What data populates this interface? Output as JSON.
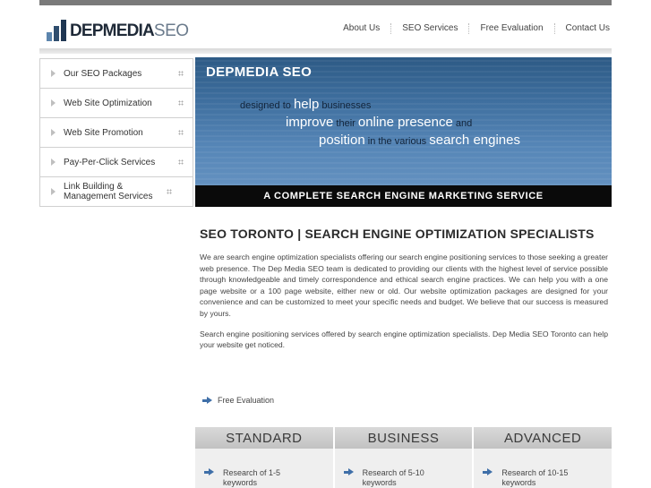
{
  "logo": {
    "main": "DEPMEDIA",
    "suffix": "SEO"
  },
  "topnav": [
    "About Us",
    "SEO Services",
    "Free Evaluation",
    "Contact Us"
  ],
  "sidebar": {
    "items": [
      {
        "label": "Our SEO Packages"
      },
      {
        "label": "Web Site Optimization"
      },
      {
        "label": "Web Site Promotion"
      },
      {
        "label": "Pay-Per-Click Services"
      },
      {
        "label": "Link Building & Management Services"
      }
    ]
  },
  "banner": {
    "title": "DEPMEDIA SEO",
    "line1": {
      "a": "designed to ",
      "b": "help",
      "c": " businesses"
    },
    "line2": {
      "a": "improve",
      "b": " their ",
      "c": "online presence",
      "d": " and"
    },
    "line3": {
      "a": "position",
      "b": " in the various ",
      "c": "search engines"
    },
    "strip": "A COMPLETE SEARCH ENGINE MARKETING SERVICE"
  },
  "main": {
    "title": "SEO TORONTO | SEARCH ENGINE OPTIMIZATION SPECIALISTS",
    "paragraph1": "We are search engine optimization specialists offering our search engine positioning services to those seeking a greater web presence. The Dep Media SEO team is dedicated to providing our clients with the highest level of service possible through knowledgeable and timely correspondence and ethical search engine practices. We can help you with a one page website or a 100 page website, either new or old. Our website optimization packages are designed for your convenience and can be customized to meet your specific needs and budget. We believe that our success is measured by yours.",
    "paragraph2": "Search engine positioning services offered by search engine optimization specialists. Dep Media SEO Toronto can help your website get noticed.",
    "free_eval": "Free Evaluation"
  },
  "packages": [
    {
      "name": "STANDARD",
      "item": "Research of 1-5 keywords"
    },
    {
      "name": "BUSINESS",
      "item": "Research of 5-10 keywords"
    },
    {
      "name": "ADVANCED",
      "item": "Research of 10-15 keywords"
    }
  ],
  "colors": {
    "banner": "#3f6f9f",
    "accent_arrow": "#3f6fa8",
    "strip": "#0a0a0a"
  }
}
